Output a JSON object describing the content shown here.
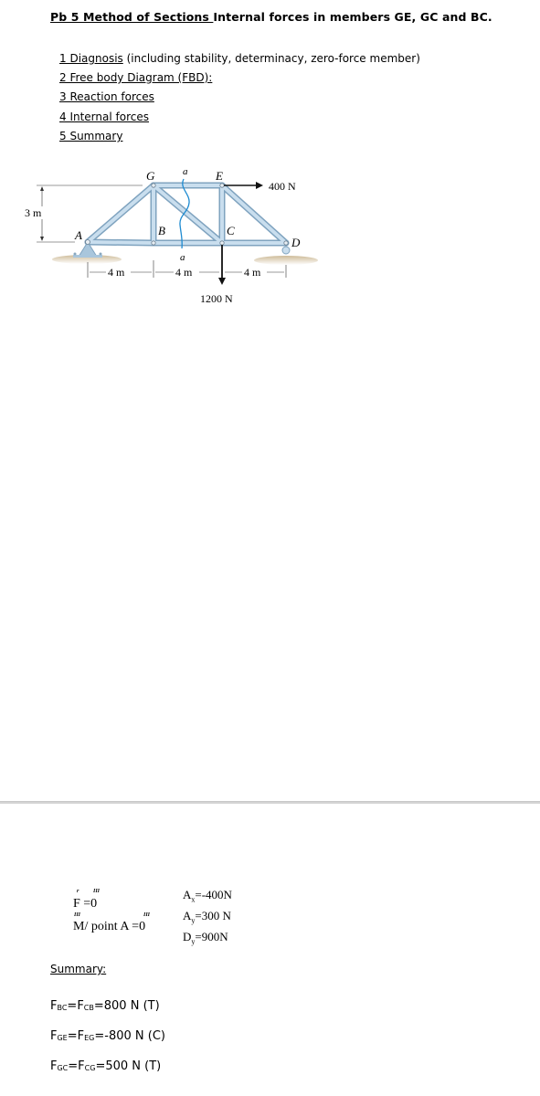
{
  "header": {
    "title_underlined": "Pb 5 Method of Sections ",
    "title_rest": "Internal forces in members GE, GC and BC."
  },
  "toc": [
    {
      "label": "1 Diagnosis",
      "suffix": " (including stability, determinacy, zero-force member)"
    },
    {
      "label": "2 Free body Diagram (FBD):",
      "suffix": ""
    },
    {
      "label": "3 Reaction forces",
      "suffix": ""
    },
    {
      "label": "4 Internal forces",
      "suffix": ""
    },
    {
      "label": "5 Summary",
      "suffix": ""
    }
  ],
  "figure": {
    "joints": {
      "A": "A",
      "B": "B",
      "C": "C",
      "D": "D",
      "E": "E",
      "G": "G"
    },
    "section_label_top": "a",
    "section_label_bottom": "a",
    "height_dim": "3 m",
    "span_dims": [
      "4 m",
      "4 m",
      "4 m"
    ],
    "load_horizontal": "400 N",
    "load_vertical": "1200 N",
    "colors": {
      "member": "#b9d3e6",
      "member_edge": "#7fa3bf",
      "section_line": "#1e8bd1",
      "ground": "#cdbb98",
      "arrow": "#111111"
    }
  },
  "equations": {
    "sum_f": {
      "marks_left": "r",
      "marks_right": "III",
      "text": "F =0"
    },
    "sum_m": {
      "marks_left": "III",
      "marks_right": "III",
      "text": "M/ point A =0"
    }
  },
  "reactions": [
    {
      "symbol": "A",
      "sub": "x",
      "value": "=-400N"
    },
    {
      "symbol": "A",
      "sub": "y",
      "value": "=300 N"
    },
    {
      "symbol": "D",
      "sub": "y",
      "value": "=900N"
    }
  ],
  "summary": {
    "title": "Summary:",
    "items": [
      {
        "f1": "F",
        "s1": "BC",
        "f2": "=F",
        "s2": "CB",
        "value": "=800 N (T)"
      },
      {
        "f1": "F",
        "s1": "GE",
        "f2": "=F",
        "s2": "EG",
        "value": "=-800 N (C)"
      },
      {
        "f1": "F",
        "s1": "GC",
        "f2": "=F",
        "s2": "CG",
        "value": "=500 N (T)"
      }
    ]
  }
}
